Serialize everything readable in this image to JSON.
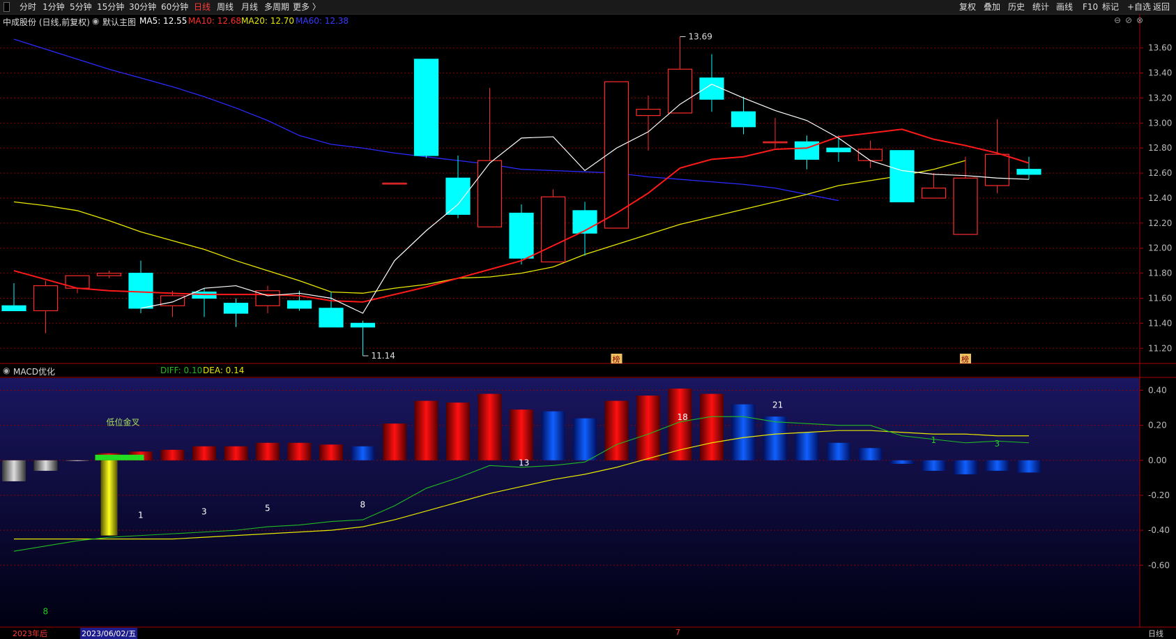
{
  "toolbar": {
    "left": [
      "分时",
      "1分钟",
      "5分钟",
      "15分钟",
      "30分钟",
      "60分钟",
      "日线",
      "周线",
      "月线",
      "多周期",
      "更多 〉"
    ],
    "active": "日线",
    "right": [
      "复权",
      "叠加",
      "历史",
      "统计",
      "画线",
      "F10",
      "标记",
      "+自选",
      "返回"
    ]
  },
  "window_controls": {
    "minimize": "⊖",
    "restore": "⊘",
    "close": "⊗"
  },
  "main_info": {
    "stock": "中成股份 (日线,前复权)",
    "template": "默认主图",
    "ma5": "MA5: 12.55",
    "ma10": "MA10: 12.68",
    "ma20": "MA20: 12.70",
    "ma60": "MA60: 12.38"
  },
  "macd_info": {
    "name": "MACD优化",
    "diff": "DIFF: 0.10",
    "dea": "DEA: 0.14"
  },
  "bottom": {
    "year": "2023年后",
    "date": "2023/06/02/五",
    "mark": "7",
    "period": "日线"
  },
  "colors": {
    "up": "#ff2b2b",
    "down": "#00ffff",
    "ma5": "#ffffff",
    "ma10": "#ff1a1a",
    "ma20": "#e8e800",
    "ma60": "#2a2aff",
    "diff": "#22bb22",
    "dea": "#e8e800",
    "grid": "#8b0000",
    "panel_bg": "#15124a"
  },
  "chart_data": [
    {
      "type": "candlestick",
      "title": "中成股份 (日线,前复权)",
      "y_ticks": [
        11.2,
        11.4,
        11.6,
        11.8,
        12.0,
        12.2,
        12.4,
        12.6,
        12.8,
        13.0,
        13.2,
        13.4,
        13.6
      ],
      "ylim": [
        11.09,
        13.76
      ],
      "candles": [
        {
          "o": 11.54,
          "h": 11.72,
          "l": 11.5,
          "c": 11.5
        },
        {
          "o": 11.5,
          "h": 11.74,
          "l": 11.32,
          "c": 11.7
        },
        {
          "o": 11.68,
          "h": 11.76,
          "l": 11.64,
          "c": 11.78
        },
        {
          "o": 11.78,
          "h": 11.82,
          "l": 11.76,
          "c": 11.8
        },
        {
          "o": 11.8,
          "h": 11.9,
          "l": 11.48,
          "c": 11.52
        },
        {
          "o": 11.54,
          "h": 11.66,
          "l": 11.45,
          "c": 11.62
        },
        {
          "o": 11.65,
          "h": 11.68,
          "l": 11.45,
          "c": 11.6
        },
        {
          "o": 11.56,
          "h": 11.6,
          "l": 11.37,
          "c": 11.48
        },
        {
          "o": 11.54,
          "h": 11.7,
          "l": 11.48,
          "c": 11.66
        },
        {
          "o": 11.58,
          "h": 11.66,
          "l": 11.5,
          "c": 11.52
        },
        {
          "o": 11.52,
          "h": 11.65,
          "l": 11.37,
          "c": 11.37
        },
        {
          "o": 11.4,
          "h": 11.42,
          "l": 11.14,
          "c": 11.37
        },
        {
          "o": 12.52,
          "h": 12.52,
          "l": 12.52,
          "c": 12.52
        },
        {
          "o": 13.51,
          "h": 13.51,
          "l": 12.72,
          "c": 12.74
        },
        {
          "o": 12.56,
          "h": 12.74,
          "l": 12.24,
          "c": 12.27
        },
        {
          "o": 12.17,
          "h": 13.28,
          "l": 12.17,
          "c": 12.7
        },
        {
          "o": 12.28,
          "h": 12.35,
          "l": 11.87,
          "c": 11.92
        },
        {
          "o": 11.89,
          "h": 12.47,
          "l": 11.89,
          "c": 12.41
        },
        {
          "o": 12.3,
          "h": 12.37,
          "l": 11.94,
          "c": 12.12
        },
        {
          "o": 12.16,
          "h": 13.33,
          "l": 12.16,
          "c": 13.33
        },
        {
          "o": 13.06,
          "h": 13.22,
          "l": 12.78,
          "c": 13.11
        },
        {
          "o": 13.08,
          "h": 13.69,
          "l": 13.08,
          "c": 13.43
        },
        {
          "o": 13.36,
          "h": 13.55,
          "l": 13.09,
          "c": 13.19
        },
        {
          "o": 13.09,
          "h": 13.21,
          "l": 12.91,
          "c": 12.97
        },
        {
          "o": 12.85,
          "h": 13.04,
          "l": 12.8,
          "c": 12.85
        },
        {
          "o": 12.85,
          "h": 12.9,
          "l": 12.63,
          "c": 12.71
        },
        {
          "o": 12.8,
          "h": 12.9,
          "l": 12.69,
          "c": 12.77
        },
        {
          "o": 12.7,
          "h": 12.86,
          "l": 12.64,
          "c": 12.79
        },
        {
          "o": 12.78,
          "h": 12.78,
          "l": 12.37,
          "c": 12.37
        },
        {
          "o": 12.4,
          "h": 12.6,
          "l": 12.4,
          "c": 12.48
        },
        {
          "o": 12.11,
          "h": 12.73,
          "l": 12.11,
          "c": 12.56
        },
        {
          "o": 12.5,
          "h": 13.03,
          "l": 12.44,
          "c": 12.75
        },
        {
          "o": 12.63,
          "h": 12.73,
          "l": 12.55,
          "c": 12.59
        }
      ],
      "ma5": [
        null,
        null,
        null,
        null,
        11.52,
        11.57,
        11.68,
        11.7,
        11.62,
        11.64,
        11.6,
        11.48,
        11.9,
        12.14,
        12.35,
        12.68,
        12.88,
        12.89,
        12.62,
        12.8,
        12.93,
        13.15,
        13.31,
        13.2,
        13.1,
        13.02,
        12.88,
        12.7,
        12.62,
        12.59,
        12.58,
        12.56,
        12.55
      ],
      "ma10": [
        11.82,
        11.75,
        11.68,
        11.66,
        11.65,
        11.64,
        11.63,
        11.63,
        11.63,
        11.62,
        11.58,
        11.57,
        11.63,
        11.69,
        11.76,
        11.83,
        11.9,
        12.02,
        12.14,
        12.28,
        12.44,
        12.64,
        12.71,
        12.73,
        12.79,
        12.8,
        12.89,
        12.92,
        12.95,
        12.87,
        12.82,
        12.76,
        12.68
      ],
      "ma20": [
        12.37,
        12.34,
        12.3,
        12.22,
        12.13,
        12.06,
        11.99,
        11.9,
        11.82,
        11.74,
        11.65,
        11.64,
        11.68,
        11.71,
        11.76,
        11.77,
        11.8,
        11.85,
        11.95,
        12.03,
        12.11,
        12.19,
        12.25,
        12.31,
        12.37,
        12.43,
        12.5,
        12.54,
        12.58,
        12.63,
        12.7
      ],
      "ma60": [
        13.67,
        13.59,
        13.51,
        13.43,
        13.36,
        13.29,
        13.21,
        13.12,
        13.02,
        12.9,
        12.83,
        12.8,
        12.76,
        12.73,
        12.7,
        12.67,
        12.63,
        12.62,
        12.61,
        12.6,
        12.57,
        12.55,
        12.53,
        12.51,
        12.48,
        12.43,
        12.38
      ],
      "annotations": [
        {
          "index": 21,
          "text": "13.69",
          "at": "high"
        },
        {
          "index": 11,
          "text": "11.14",
          "at": "low"
        },
        {
          "index": 19,
          "text": "榜",
          "at": "bottom"
        },
        {
          "index": 30,
          "text": "榜",
          "at": "bottom"
        }
      ]
    },
    {
      "type": "bar",
      "title": "MACD优化",
      "y_ticks": [
        0.4,
        0.2,
        0.0,
        -0.2,
        -0.4,
        -0.6
      ],
      "ylim": [
        -0.95,
        0.47
      ],
      "histogram": [
        -0.12,
        -0.06,
        0,
        0.04,
        0.05,
        0.06,
        0.08,
        0.08,
        0.1,
        0.1,
        0.09,
        0.08,
        0.21,
        0.34,
        0.33,
        0.38,
        0.29,
        0.28,
        0.24,
        0.34,
        0.37,
        0.41,
        0.38,
        0.32,
        0.25,
        0.16,
        0.1,
        0.07,
        -0.02,
        -0.06,
        -0.08,
        -0.06,
        -0.07
      ],
      "histogram_colors": [
        "gray",
        "gray",
        "gray",
        "red",
        "red",
        "red",
        "red",
        "red",
        "red",
        "red",
        "red",
        "blue",
        "red",
        "red",
        "red",
        "red",
        "red",
        "blue",
        "blue",
        "red",
        "red",
        "red",
        "red",
        "blue",
        "blue",
        "blue",
        "blue",
        "blue",
        "blue",
        "blue",
        "blue",
        "blue",
        "blue"
      ],
      "special_bar": {
        "index": 3,
        "value": -0.43,
        "color": "yellow"
      },
      "diff": [
        -0.52,
        -0.49,
        -0.46,
        -0.44,
        -0.43,
        -0.42,
        -0.41,
        -0.4,
        -0.38,
        -0.37,
        -0.35,
        -0.34,
        -0.26,
        -0.16,
        -0.1,
        -0.03,
        -0.04,
        -0.03,
        -0.01,
        0.09,
        0.15,
        0.22,
        0.25,
        0.25,
        0.22,
        0.21,
        0.2,
        0.2,
        0.14,
        0.12,
        0.1,
        0.11,
        0.1
      ],
      "dea": [
        -0.45,
        -0.45,
        -0.45,
        -0.45,
        -0.45,
        -0.45,
        -0.44,
        -0.43,
        -0.42,
        -0.41,
        -0.4,
        -0.38,
        -0.34,
        -0.29,
        -0.24,
        -0.19,
        -0.15,
        -0.11,
        -0.08,
        -0.04,
        0.01,
        0.06,
        0.1,
        0.13,
        0.15,
        0.16,
        0.17,
        0.17,
        0.16,
        0.15,
        0.15,
        0.14,
        0.14
      ],
      "labels": [
        {
          "text": "低位金叉",
          "index": 3,
          "y": 0.2,
          "color": "#a8e060"
        },
        {
          "text": "1",
          "index": 4,
          "y": -0.33,
          "color": "#ffffff"
        },
        {
          "text": "3",
          "index": 6,
          "y": -0.31,
          "color": "#ffffff"
        },
        {
          "text": "5",
          "index": 8,
          "y": -0.29,
          "color": "#ffffff"
        },
        {
          "text": "8",
          "index": 11,
          "y": -0.27,
          "color": "#ffffff"
        },
        {
          "text": "13",
          "index": 16,
          "y": -0.03,
          "color": "#ffffff"
        },
        {
          "text": "18",
          "index": 21,
          "y": 0.23,
          "color": "#ffffff"
        },
        {
          "text": "21",
          "index": 24,
          "y": 0.3,
          "color": "#ffffff"
        },
        {
          "text": "1",
          "index": 29,
          "y": 0.1,
          "color": "#22cc22"
        },
        {
          "text": "3",
          "index": 31,
          "y": 0.08,
          "color": "#22cc22"
        },
        {
          "text": "8",
          "index": 1,
          "y": -0.88,
          "color": "#22cc22"
        }
      ]
    }
  ]
}
